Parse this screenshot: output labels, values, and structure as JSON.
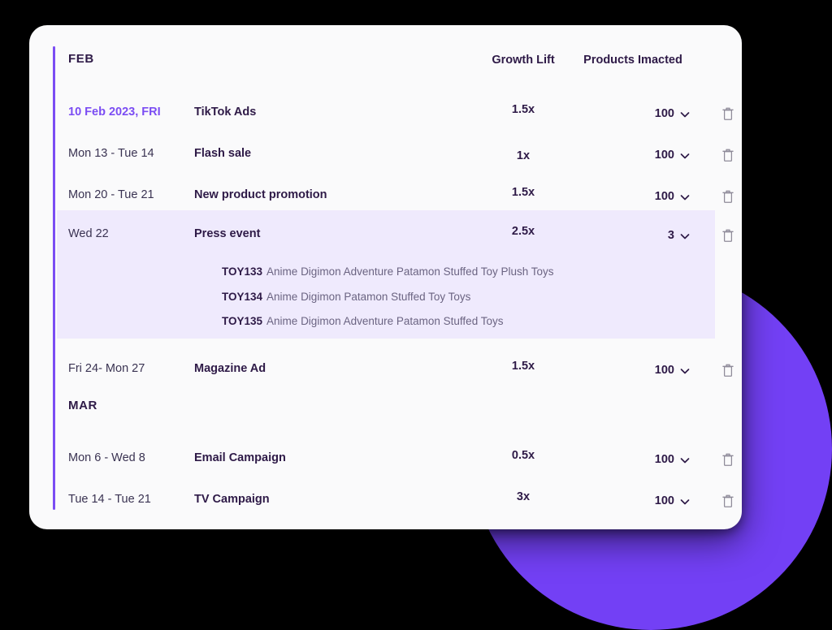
{
  "theme": {
    "page_background": "#000000",
    "card_background": "#FAFAFB",
    "accent_purple": "#7B4DF3",
    "circle_purple": "#7340F5",
    "highlight_row": "#EFEAFD",
    "text_dark": "#2E1A47",
    "text_muted": "#6B6482",
    "icon_gray": "#8E8B99"
  },
  "header": {
    "month": "FEB",
    "growth_lift": "Growth Lift",
    "products_impacted": "Products Imacted"
  },
  "months": [
    {
      "label": "FEB"
    },
    {
      "label": "MAR"
    }
  ],
  "rows": [
    {
      "date": "10 Feb 2023, FRI",
      "date_accent": true,
      "name": "TikTok Ads",
      "growth_lift": "1.5x",
      "products": "100",
      "highlight": false,
      "products_list": []
    },
    {
      "date": "Mon 13  - Tue 14",
      "date_accent": false,
      "name": "Flash sale",
      "growth_lift": "1x",
      "products": "100",
      "highlight": false,
      "products_list": []
    },
    {
      "date": "Mon 20 - Tue 21",
      "date_accent": false,
      "name": "New product promotion",
      "growth_lift": "1.5x",
      "products": "100",
      "highlight": false,
      "products_list": []
    },
    {
      "date": "Wed 22",
      "date_accent": false,
      "name": "Press event",
      "growth_lift": "2.5x",
      "products": "3",
      "highlight": true,
      "products_list": [
        {
          "sku": "TOY133",
          "title": "Anime Digimon Adventure Patamon Stuffed Toy Plush Toys"
        },
        {
          "sku": "TOY134",
          "title": "Anime Digimon  Patamon Stuffed Toy  Toys"
        },
        {
          "sku": "TOY135",
          "title": "Anime Digimon Adventure Patamon Stuffed Toys"
        }
      ]
    },
    {
      "date": "Fri 24- Mon 27",
      "date_accent": false,
      "name": "Magazine Ad",
      "growth_lift": "1.5x",
      "products": "100",
      "highlight": false,
      "products_list": []
    },
    {
      "date": "Mon 6 - Wed 8",
      "date_accent": false,
      "name": "Email Campaign",
      "growth_lift": "0.5x",
      "products": "100",
      "highlight": false,
      "products_list": []
    },
    {
      "date": "Tue 14 - Tue 21",
      "date_accent": false,
      "name": "TV Campaign",
      "growth_lift": "3x",
      "products": "100",
      "highlight": false,
      "products_list": []
    }
  ],
  "icons": {
    "chevron": "chevron-down-icon",
    "delete": "trash-icon"
  }
}
